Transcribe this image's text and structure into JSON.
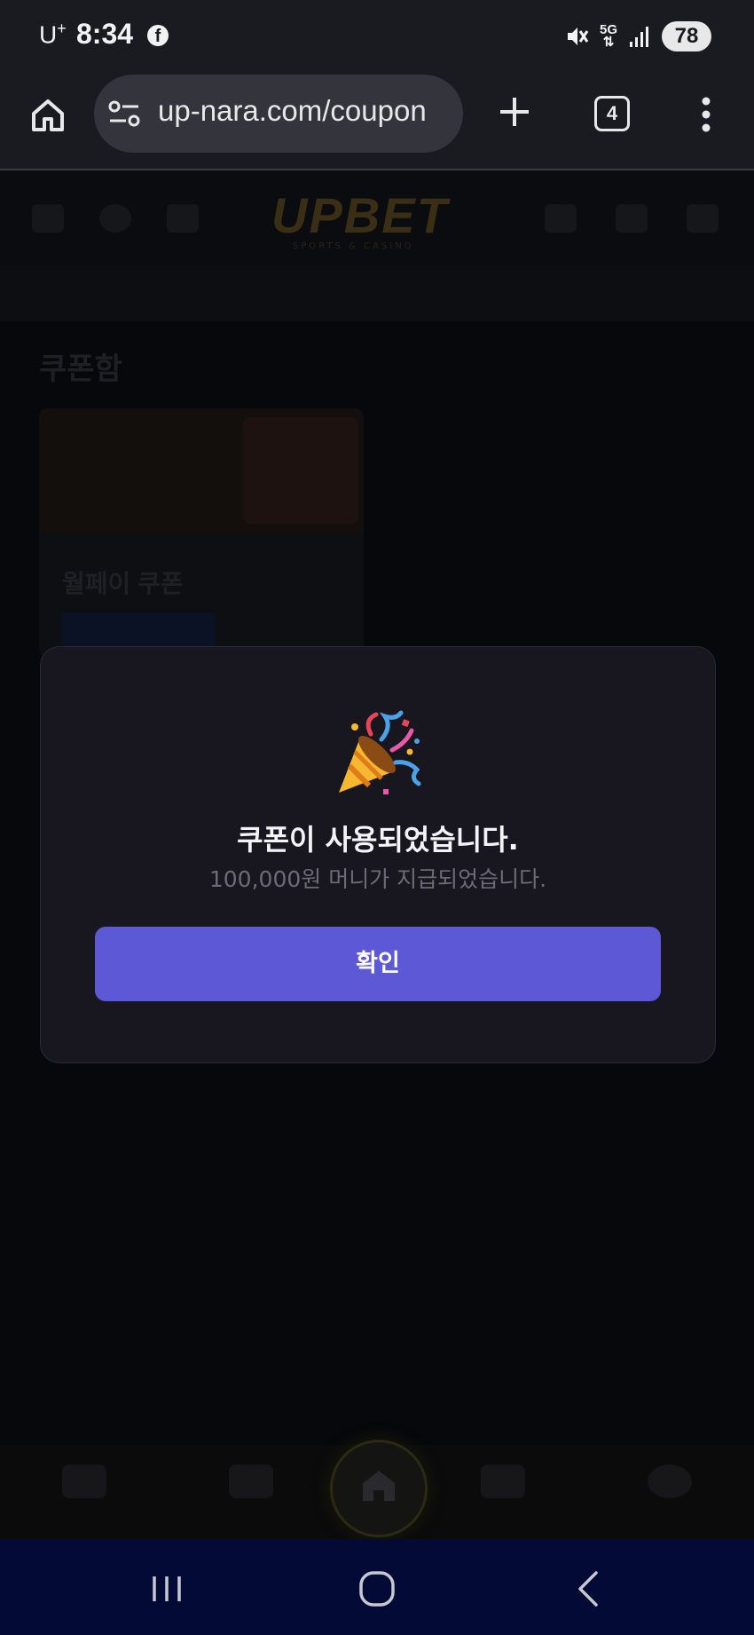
{
  "status_bar": {
    "carrier": "U",
    "carrier_sup": "+",
    "time": "8:34",
    "network": "5G",
    "battery": "78"
  },
  "browser": {
    "url": "up-nara.com/coupon",
    "tab_count": "4"
  },
  "background_page": {
    "logo": "UPBET",
    "logo_sub": "SPORTS & CASINO",
    "section_title": "쿠폰함",
    "card_title": "월페이 쿠폰"
  },
  "modal": {
    "emoji": "🎉",
    "title": "쿠폰이 사용되었습니다.",
    "message": "100,000원 머니가 지급되었습니다.",
    "confirm_label": "확인"
  },
  "colors": {
    "accent": "#5c58d6",
    "modal_bg": "#18161f",
    "system_nav": "#020a35"
  }
}
